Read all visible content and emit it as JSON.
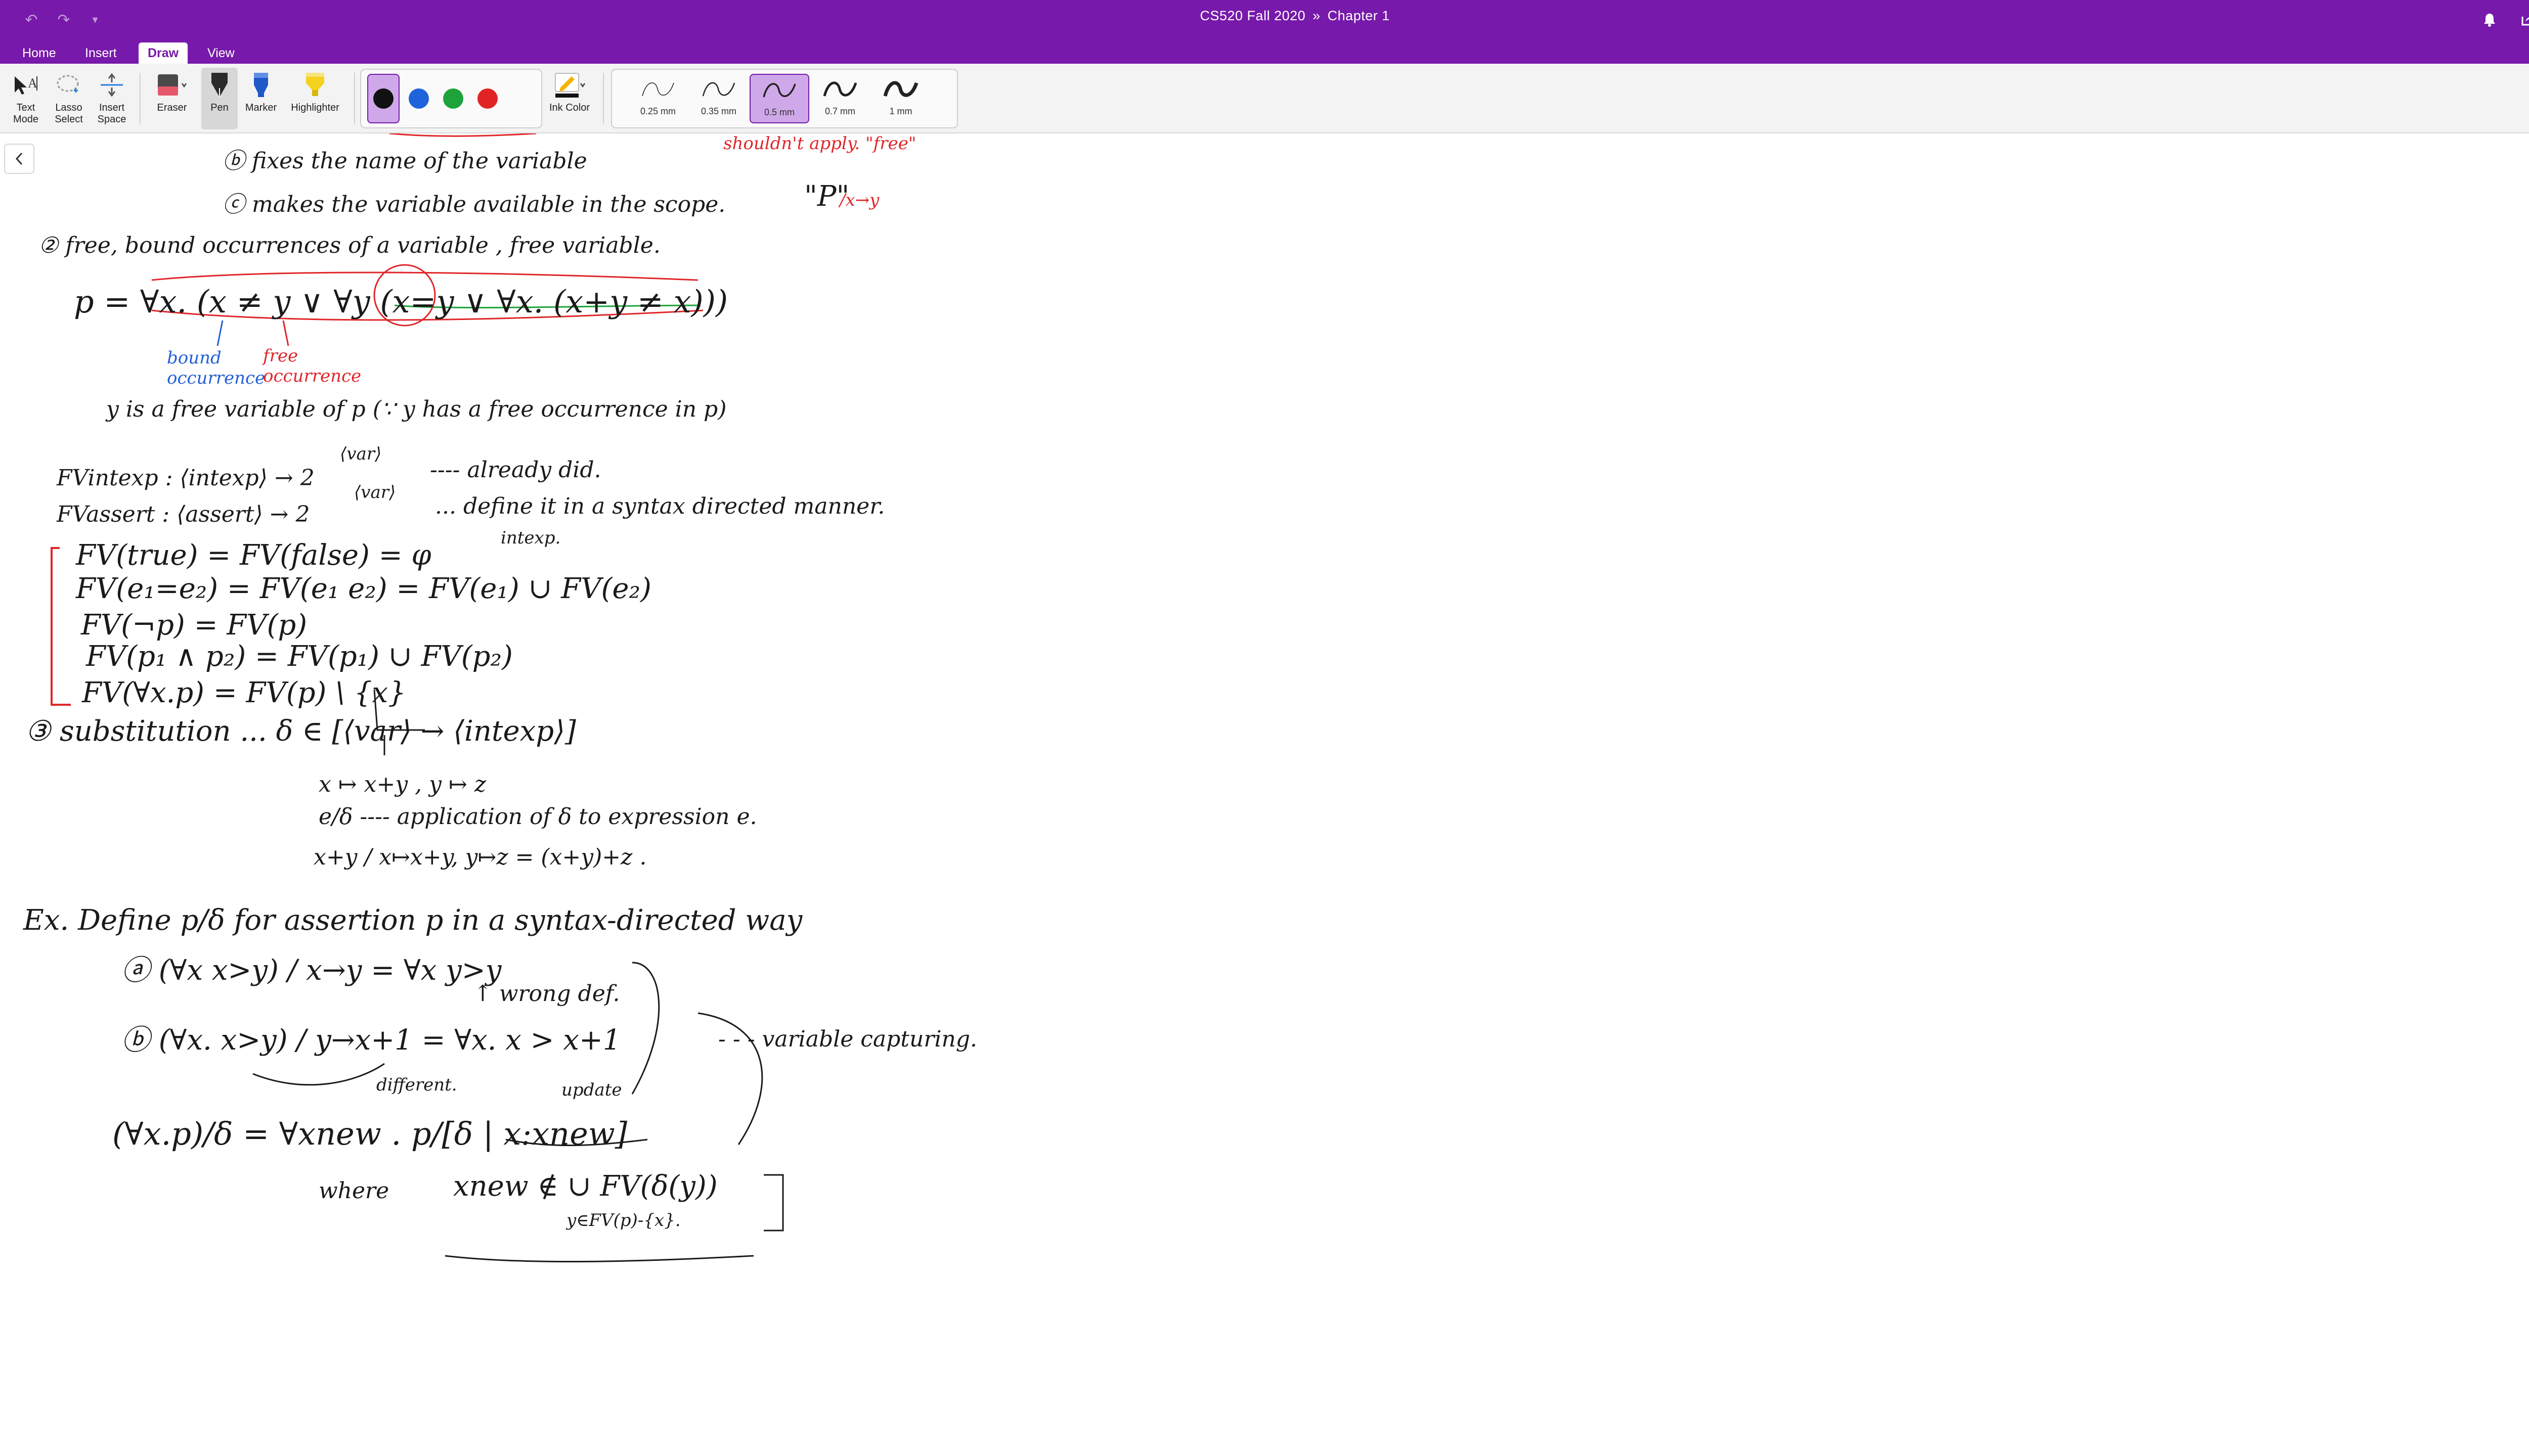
{
  "app": {
    "brand_color": "#7719aa",
    "title_notebook": "CS520 Fall 2020",
    "title_separator": "»",
    "title_page": "Chapter 1"
  },
  "quick_access": {
    "undo_icon": "undo-icon",
    "redo_icon": "redo-icon",
    "customize_icon": "chevron-down-icon"
  },
  "title_icons": [
    "bell-icon",
    "share-icon",
    "expand-icon"
  ],
  "tabs": [
    {
      "label": "Home",
      "active": false
    },
    {
      "label": "Insert",
      "active": false
    },
    {
      "label": "Draw",
      "active": true
    },
    {
      "label": "View",
      "active": false
    }
  ],
  "ribbon": {
    "text_mode": "Text\nMode",
    "lasso_select": "Lasso\nSelect",
    "insert_space": "Insert\nSpace",
    "eraser": "Eraser",
    "pen": "Pen",
    "marker": "Marker",
    "highlighter": "Highlighter",
    "ink_color": "Ink Color",
    "colors": [
      {
        "name": "black",
        "hex": "#111111",
        "selected": true
      },
      {
        "name": "blue",
        "hex": "#1e63dc",
        "selected": false
      },
      {
        "name": "green",
        "hex": "#1ea33a",
        "selected": false
      },
      {
        "name": "red",
        "hex": "#e02424",
        "selected": false
      }
    ],
    "thicknesses": [
      {
        "label": "0.25 mm",
        "selected": false
      },
      {
        "label": "0.35 mm",
        "selected": false
      },
      {
        "label": "0.5 mm",
        "selected": true
      },
      {
        "label": "0.7 mm",
        "selected": false
      },
      {
        "label": "1 mm",
        "selected": false
      }
    ]
  },
  "notes": {
    "l_b": "ⓑ fixes the name of the variable",
    "l_c": "ⓒ makes the variable available in the scope.",
    "l_c_aside": "\"P\"",
    "l_c_aside_red": "/x→y",
    "red_top": "shouldn't apply. \"free\"",
    "l2": "② free, bound occurrences of a variable , free variable.",
    "p_def": "p = ∀x. (x ≠ y ∨ ∀y (x=y ∨ ∀x. (x+y ≠ x)))",
    "bound_occ": "bound occurrence",
    "free_occ": "free occurrence",
    "y_free": "y is a free variable of p (∵ y has a free occurrence in p)",
    "fv_intexp": "FVintexp : ⟨intexp⟩ → 2",
    "fv_intexp_sup": "⟨var⟩",
    "fv_intexp_note": "---- already did.",
    "fv_assert": "FVassert : ⟨assert⟩ → 2",
    "fv_assert_sup": "⟨var⟩",
    "fv_assert_note": "... define it in a syntax directed manner.",
    "intexp_note": "intexp.",
    "fv1": "FV(true) = FV(false) = φ",
    "fv2": "FV(e₁=e₂) = FV(e₁ e₂) = FV(e₁) ∪ FV(e₂)",
    "fv3": "FV(¬p) = FV(p)",
    "fv4": "FV(p₁ ∧ p₂) = FV(p₁) ∪ FV(p₂)",
    "fv5": "FV(∀x.p) = FV(p) \\ {x}",
    "subst": "③ substitution ...   δ ∈ [⟨var⟩ → ⟨intexp⟩]",
    "subst_ex": "x ↦ x+y , y ↦ z",
    "subst_app": "e/δ ---- application of δ to expression e.",
    "subst_eg": "x+y / x↦x+y, y↦z   = (x+y)+z .",
    "ex": "Ex.  Define p/δ for assertion p in a syntax-directed way",
    "ex_a": "ⓐ  (∀x x>y) / x→y   = ∀x y>y",
    "wrong_def": "↑ wrong def.",
    "ex_b": "ⓑ  (∀x. x>y) / y→x+1   = ∀x. x > x+1",
    "different": "different.",
    "update": "update",
    "capturing": "- - - variable capturing.",
    "gen": "(∀x.p)/δ   = ∀xnew . p/[δ | x:xnew]",
    "where": "where",
    "xnew": "xnew ∉ ∪ FV(δ(y))",
    "xnew_sub": "y∈FV(p)-{x}."
  }
}
